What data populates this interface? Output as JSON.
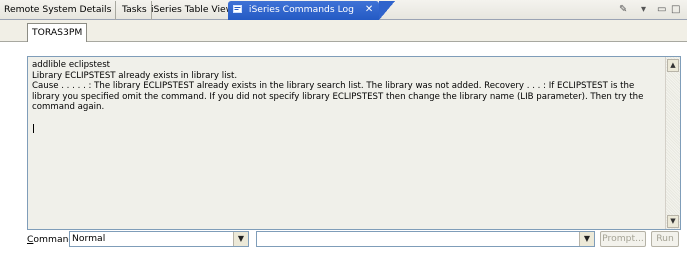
{
  "view_tabs": [
    {
      "label": "Remote System Details"
    },
    {
      "label": "Tasks"
    },
    {
      "label": "iSeries Table View"
    },
    {
      "label": "iSeries Commands Log",
      "icon": "commands-log-icon",
      "close": "✕"
    }
  ],
  "toolbar": {
    "pen_icon": "✎",
    "menu_icon": "▾",
    "minimize_icon": "▭",
    "maximize_icon": "□"
  },
  "sub_tab": {
    "label": "TORAS3PM"
  },
  "log": {
    "lines": [
      "addlible eclipstest",
      "Library ECLIPSTEST already exists in library list.",
      "Cause . . . . . :   The library ECLIPSTEST already exists in the library search list. The library was not added. Recovery  . . . :   If ECLIPSTEST is the library you specified omit the command. If you did not specify library ECLIPSTEST then change the library name (LIB parameter). Then try the command again."
    ]
  },
  "command_bar": {
    "label_prefix": "C",
    "label_rest": "ommand",
    "mode_value": "Normal",
    "command_value": "",
    "prompt_label": "Prompt...",
    "run_label": "Run"
  },
  "colors": {
    "active_tab": "#245ac4",
    "tab_bar": "#e7e6df",
    "log_background": "#f0f0ea",
    "border": "#7f9db9"
  }
}
